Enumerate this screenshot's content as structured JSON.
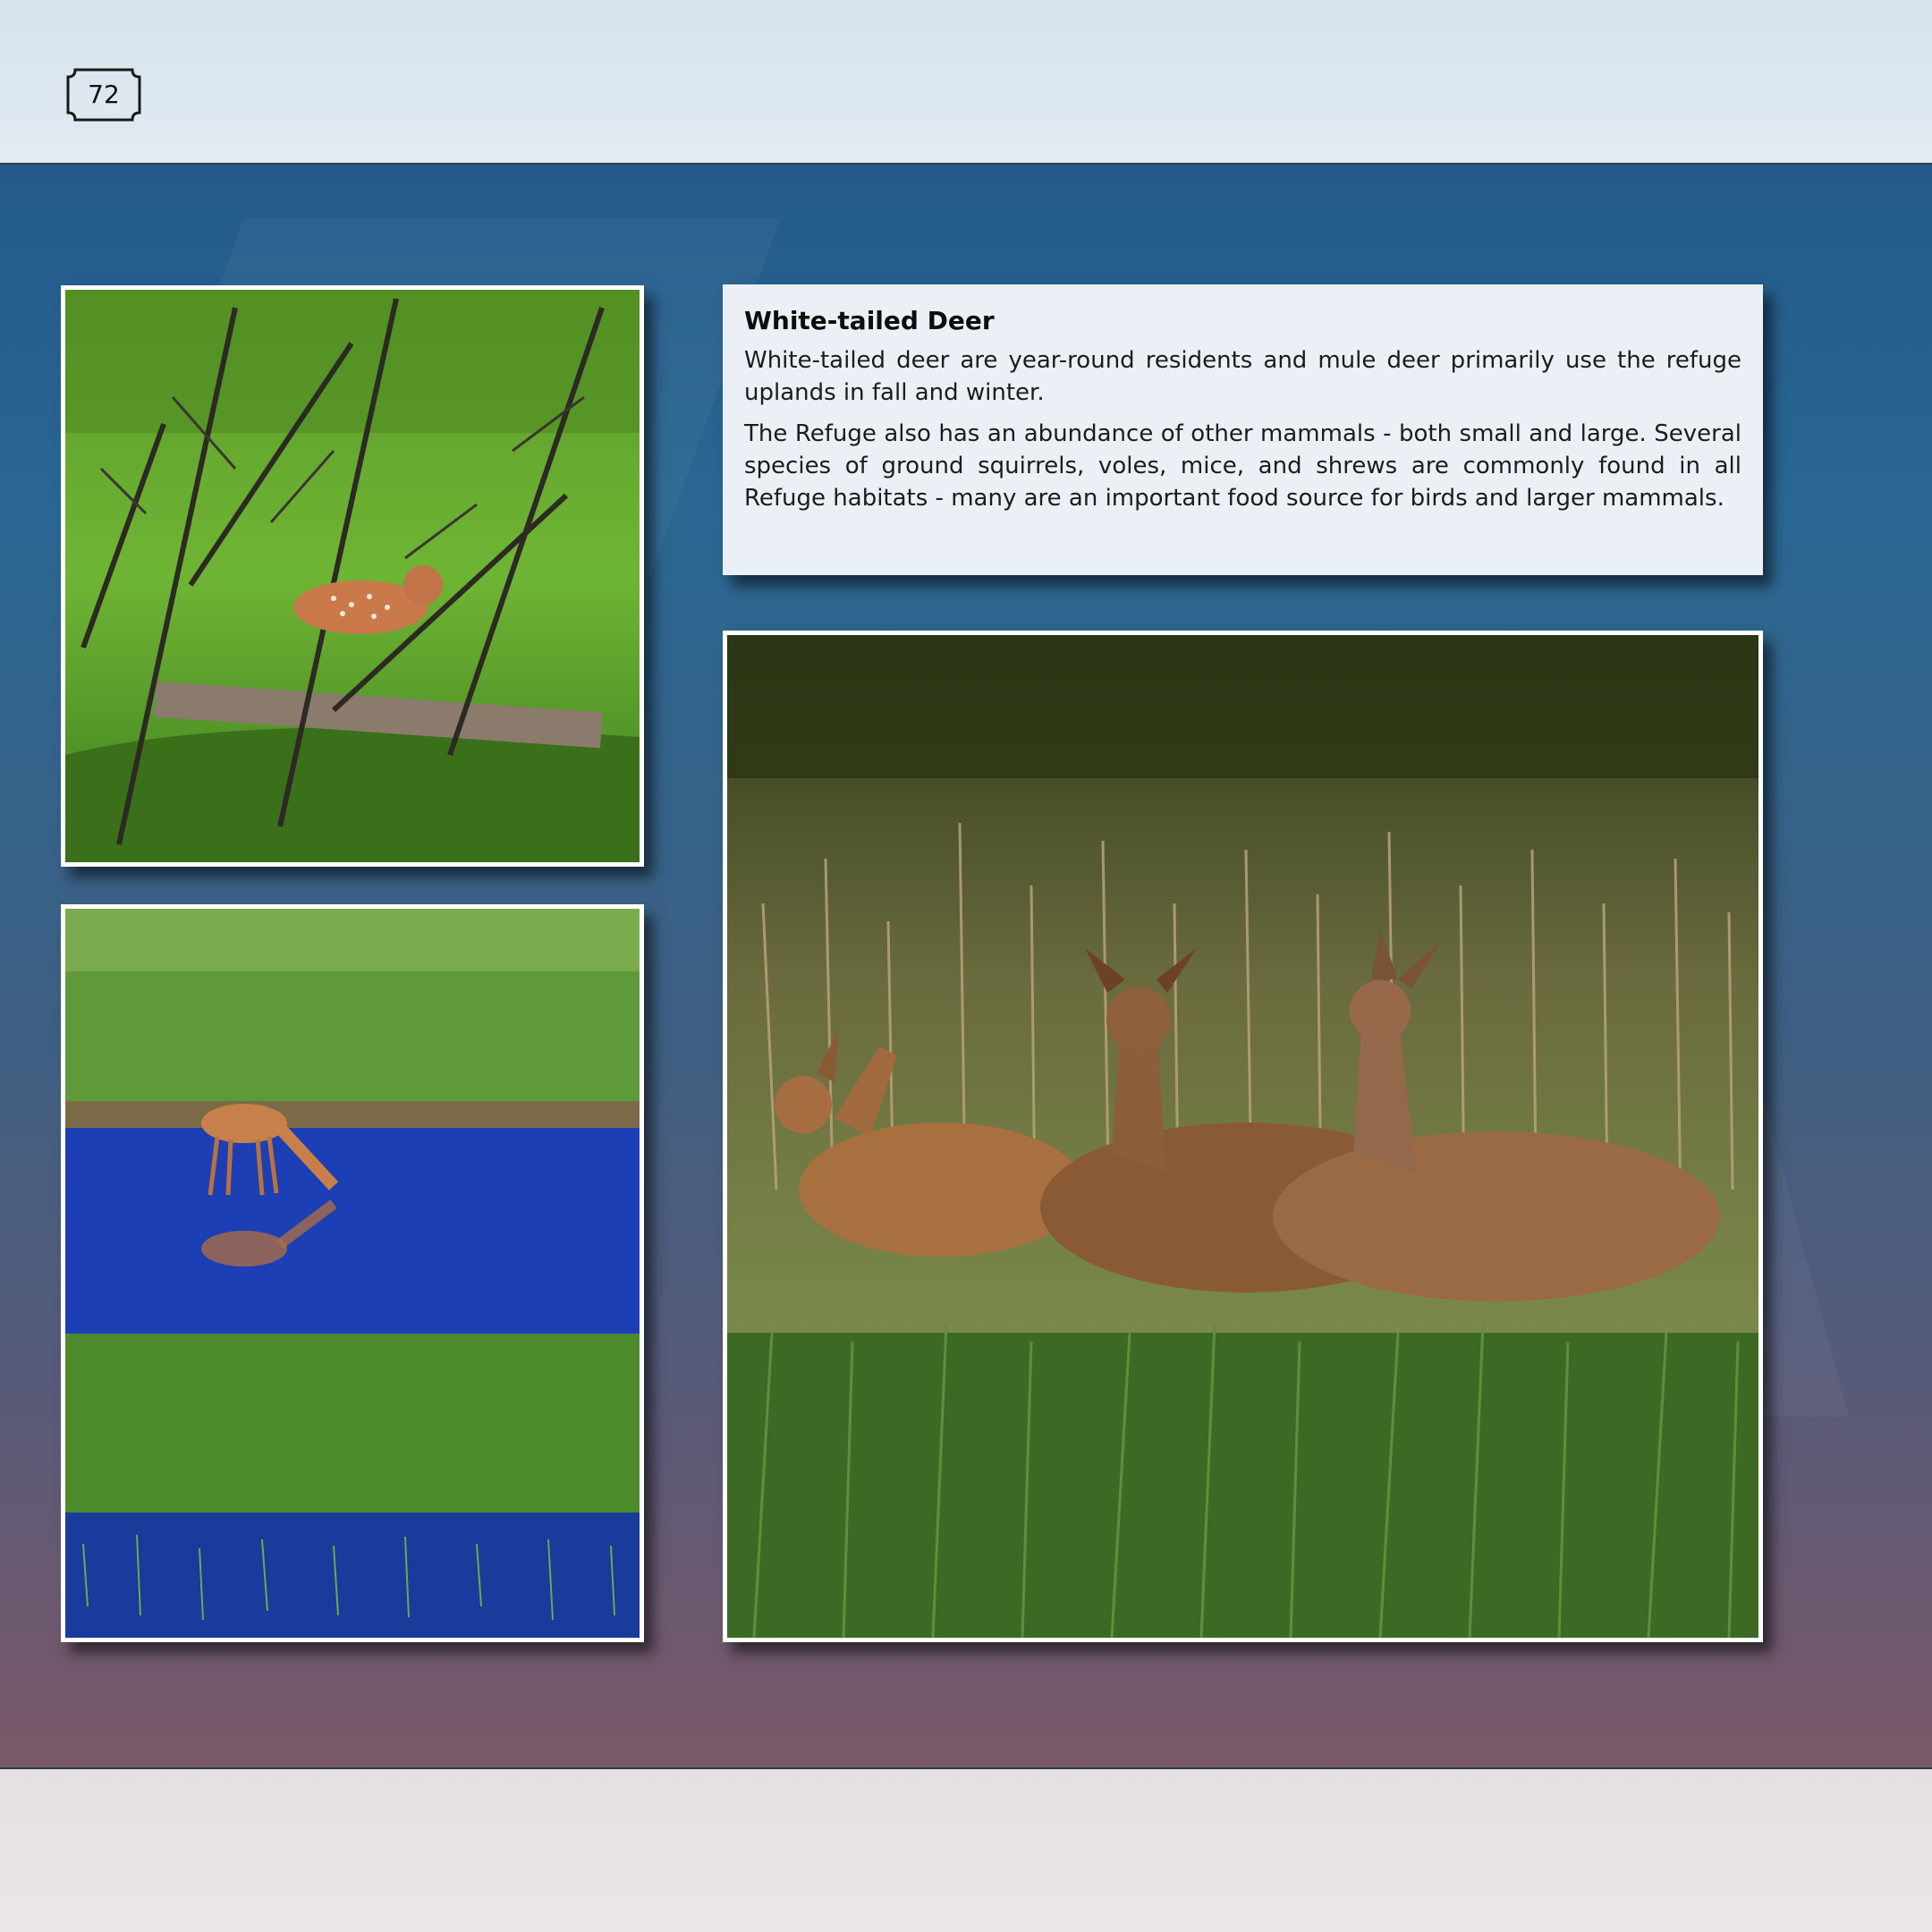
{
  "page": {
    "number": "72"
  },
  "article": {
    "title": "White-tailed Deer",
    "paragraphs": [
      "White-tailed deer are year-round residents and mule deer primarily use the refuge uplands in fall and winter.",
      "The Refuge also has an abundance of other mammals - both small and large. Several species of ground squirrels, voles, mice, and shrews are commonly found in all Refuge habitats - many are an important food source for birds and larger mammals."
    ]
  },
  "colors": {
    "band_top": "#d5e2ed",
    "band_main_top": "#235a8a",
    "band_main_bottom": "#7a5868",
    "card_background": "#eaf0f5",
    "photo_border": "#ffffff"
  },
  "photos": [
    {
      "id": "fawn-in-forest",
      "subject": "fawn resting in green grass among bare branches"
    },
    {
      "id": "deer-drinking",
      "subject": "deer drinking from a blue pond with reflection"
    },
    {
      "id": "three-deer",
      "subject": "three deer standing in tall grass"
    }
  ]
}
